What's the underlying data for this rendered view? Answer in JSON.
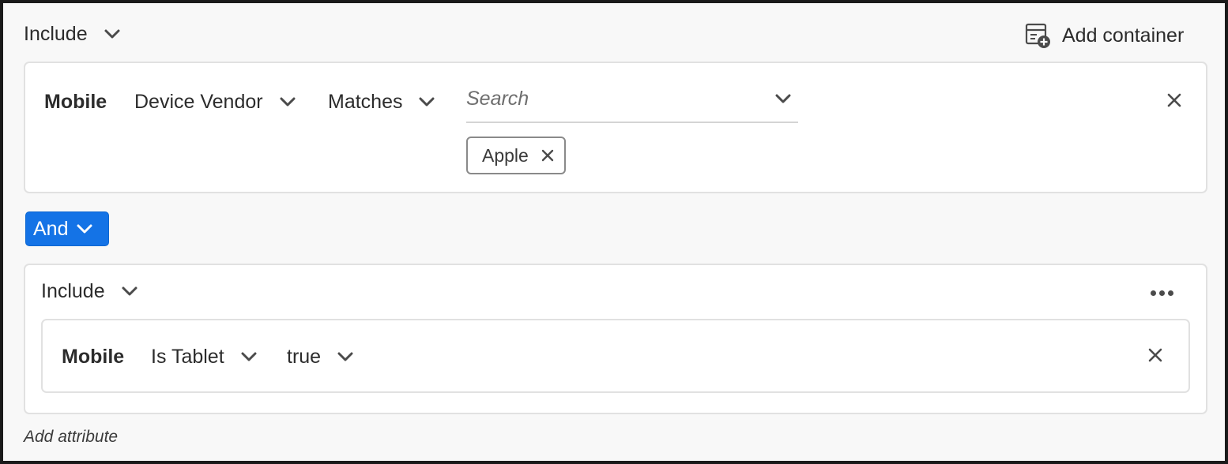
{
  "outer_container": {
    "include_label": "Include",
    "add_container_label": "Add container",
    "add_container_icon": "add-container-icon"
  },
  "rule1": {
    "category": "Mobile",
    "attribute": "Device Vendor",
    "operator": "Matches",
    "search_placeholder": "Search",
    "tags": [
      {
        "label": "Apple"
      }
    ]
  },
  "logic": {
    "operator_label": "And",
    "accent_color": "#1473e6"
  },
  "inner_container": {
    "include_label": "Include",
    "more_icon": "more-options-icon",
    "rule": {
      "category": "Mobile",
      "attribute": "Is Tablet",
      "value": "true"
    }
  },
  "footer": {
    "add_attribute_label": "Add attribute"
  }
}
